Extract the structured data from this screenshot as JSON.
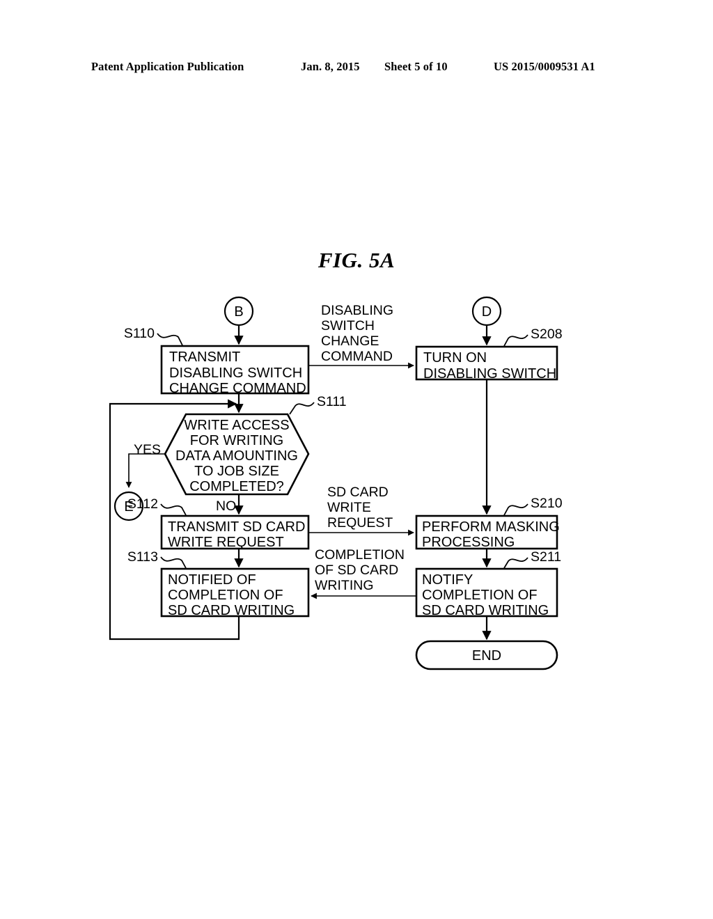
{
  "header": {
    "publication": "Patent Application Publication",
    "date": "Jan. 8, 2015",
    "sheet": "Sheet 5 of 10",
    "patent_number": "US 2015/0009531 A1"
  },
  "figure": {
    "title": "FIG. 5A"
  },
  "chart_data": {
    "type": "diagram",
    "diagram_kind": "flowchart",
    "title": "FIG. 5A",
    "lanes": [
      {
        "id": "left",
        "entry_connector": "B"
      },
      {
        "id": "right",
        "entry_connector": "D"
      }
    ],
    "connectors": [
      {
        "id": "B",
        "label": "B",
        "lane": "left",
        "role": "entry"
      },
      {
        "id": "D",
        "label": "D",
        "lane": "right",
        "role": "entry"
      },
      {
        "id": "E",
        "label": "E",
        "lane": "left",
        "role": "exit"
      }
    ],
    "nodes": [
      {
        "id": "S110",
        "step": "S110",
        "shape": "process",
        "lane": "left",
        "lines": [
          "TRANSMIT",
          "DISABLING SWITCH",
          "CHANGE COMMAND"
        ]
      },
      {
        "id": "S111",
        "step": "S111",
        "shape": "decision-hexagon",
        "lane": "left",
        "lines": [
          "WRITE ACCESS",
          "FOR WRITING",
          "DATA AMOUNTING",
          "TO JOB SIZE",
          "COMPLETED?"
        ]
      },
      {
        "id": "S112",
        "step": "S112",
        "shape": "process",
        "lane": "left",
        "lines": [
          "TRANSMIT SD CARD",
          "WRITE REQUEST"
        ]
      },
      {
        "id": "S113",
        "step": "S113",
        "shape": "process",
        "lane": "left",
        "lines": [
          "NOTIFIED OF",
          "COMPLETION OF",
          "SD CARD WRITING"
        ]
      },
      {
        "id": "S208",
        "step": "S208",
        "shape": "process",
        "lane": "right",
        "lines": [
          "TURN ON",
          "DISABLING SWITCH"
        ]
      },
      {
        "id": "S210",
        "step": "S210",
        "shape": "process",
        "lane": "right",
        "lines": [
          "PERFORM MASKING",
          "PROCESSING"
        ]
      },
      {
        "id": "S211",
        "step": "S211",
        "shape": "process",
        "lane": "right",
        "lines": [
          "NOTIFY",
          "COMPLETION OF",
          "SD CARD WRITING"
        ]
      },
      {
        "id": "END",
        "step": "",
        "shape": "terminator",
        "lane": "right",
        "lines": [
          "END"
        ]
      }
    ],
    "branch_labels": [
      {
        "id": "yes",
        "text": "YES",
        "from": "S111",
        "to": "E"
      },
      {
        "id": "no",
        "text": "NO",
        "from": "S111",
        "to": "S112"
      }
    ],
    "cross_lane_messages": [
      {
        "id": "msg-change-command",
        "direction": "left-to-right",
        "from": "S110",
        "to": "S208",
        "lines": [
          "DISABLING",
          "SWITCH",
          "CHANGE",
          "COMMAND"
        ]
      },
      {
        "id": "msg-write-request",
        "direction": "left-to-right",
        "from": "S112",
        "to": "S210",
        "lines": [
          "SD CARD",
          "WRITE",
          "REQUEST"
        ]
      },
      {
        "id": "msg-completion",
        "direction": "right-to-left",
        "from": "S211",
        "to": "S113",
        "lines": [
          "COMPLETION",
          "OF SD CARD",
          "WRITING"
        ]
      }
    ],
    "loops": [
      {
        "id": "loop-retry",
        "from": "S113",
        "to": "S111",
        "note": "return to decision"
      }
    ]
  },
  "steps": {
    "s110": "S110",
    "s111": "S111",
    "s112": "S112",
    "s113": "S113",
    "s208": "S208",
    "s210": "S210",
    "s211": "S211"
  },
  "connectors": {
    "b": "B",
    "d": "D",
    "e": "E"
  },
  "nodes": {
    "s110": {
      "l1": "TRANSMIT",
      "l2": "DISABLING SWITCH",
      "l3": "CHANGE COMMAND"
    },
    "s111": {
      "l1": "WRITE ACCESS",
      "l2": "FOR WRITING",
      "l3": "DATA AMOUNTING",
      "l4": "TO JOB SIZE",
      "l5": "COMPLETED?"
    },
    "s112": {
      "l1": "TRANSMIT SD CARD",
      "l2": "WRITE REQUEST"
    },
    "s113": {
      "l1": "NOTIFIED OF",
      "l2": "COMPLETION OF",
      "l3": "SD CARD WRITING"
    },
    "s208": {
      "l1": "TURN ON",
      "l2": "DISABLING SWITCH"
    },
    "s210": {
      "l1": "PERFORM MASKING",
      "l2": "PROCESSING"
    },
    "s211": {
      "l1": "NOTIFY",
      "l2": "COMPLETION OF",
      "l3": "SD CARD WRITING"
    },
    "end": {
      "l1": "END"
    }
  },
  "branches": {
    "yes": "YES",
    "no": "NO"
  },
  "messages": {
    "change_command": {
      "l1": "DISABLING",
      "l2": "SWITCH",
      "l3": "CHANGE",
      "l4": "COMMAND"
    },
    "write_request": {
      "l1": "SD CARD",
      "l2": "WRITE",
      "l3": "REQUEST"
    },
    "completion": {
      "l1": "COMPLETION",
      "l2": "OF SD CARD",
      "l3": "WRITING"
    }
  }
}
